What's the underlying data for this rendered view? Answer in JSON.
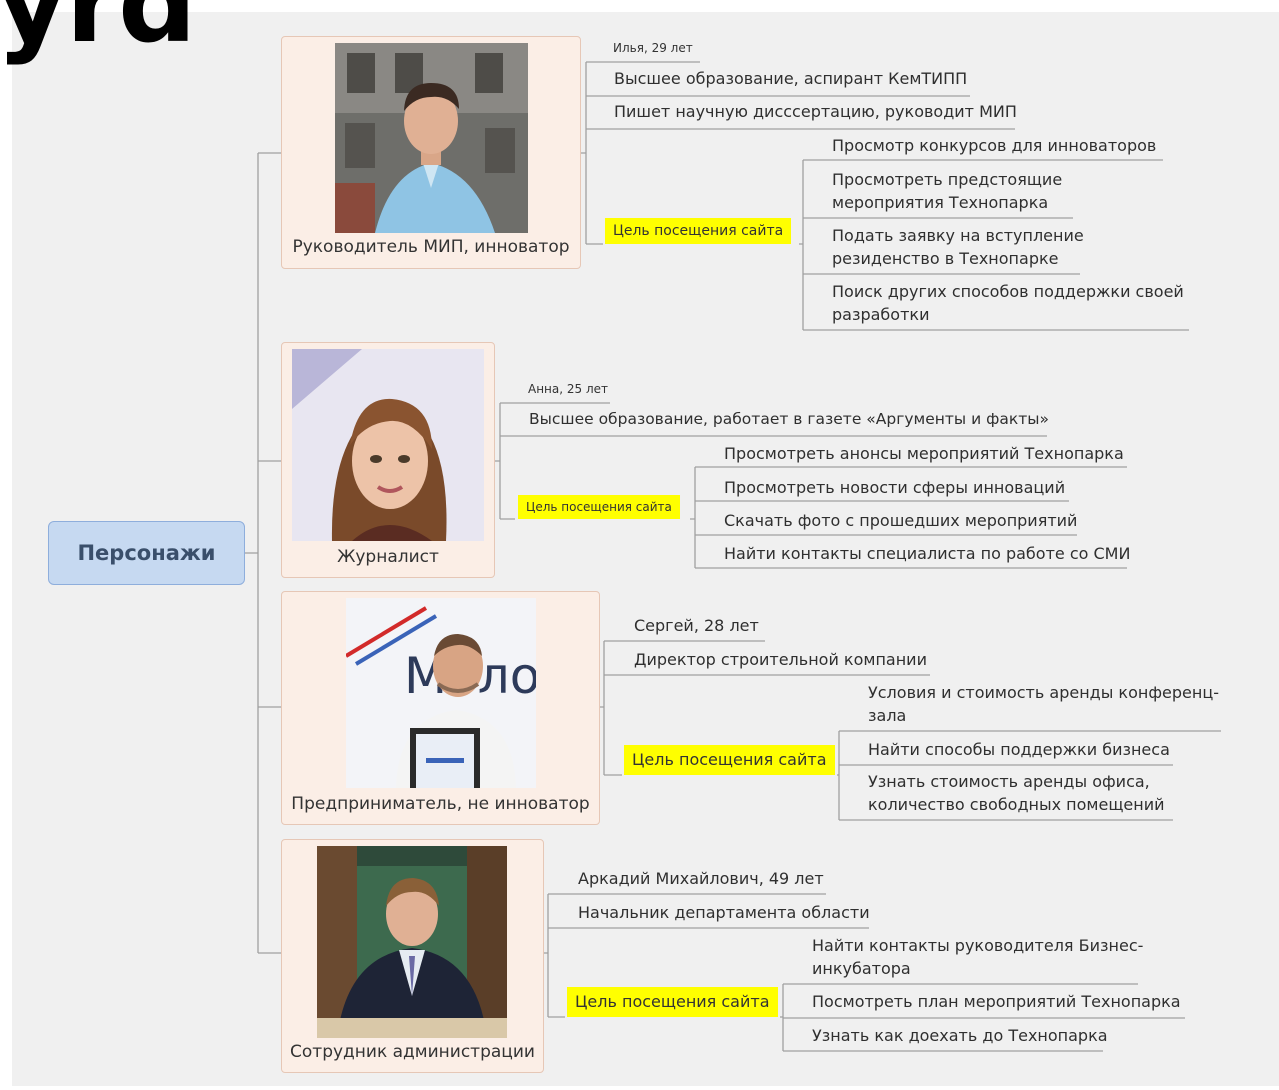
{
  "heading_fragment": "yrd",
  "root": "Персонажи",
  "personas": [
    {
      "caption": "Руководитель МИП, инноватор",
      "age": "Илья, 29 лет",
      "details": [
        "Высшее образование, аспирант КемТИПП",
        "Пишет научную дисссертацию, руководит МИП"
      ],
      "goal_label": "Цель посещения сайта",
      "goals": [
        "Просмотр конкурсов для инноваторов",
        "Просмотреть предстоящие\nмероприятия Технопарка",
        "Подать заявку на вступление\nрезиденство в Технопарке",
        "Поиск других способов поддержки своей\nразработки"
      ]
    },
    {
      "caption": "Журналист",
      "age": "Анна, 25 лет",
      "details": [
        "Высшее образование, работает в газете «Аргументы и факты»"
      ],
      "goal_label": "Цель посещения сайта",
      "goals": [
        "Просмотреть анонсы мероприятий Технопарка",
        "Просмотреть новости сферы инноваций",
        "Скачать фото с прошедших мероприятий",
        "Найти контакты специалиста по работе со СМИ"
      ]
    },
    {
      "caption": "Предприниматель, не инноватор",
      "details": [
        "Сергей, 28 лет",
        "Директор строительной компании"
      ],
      "goal_label": "Цель посещения сайта",
      "goals": [
        "Условия и стоимость аренды конференц-\nзала",
        "Найти способы поддержки бизнеса",
        "Узнать стоимость аренды офиса,\nколичество свободных помещений"
      ],
      "photo_text": "Молод"
    },
    {
      "caption": "Сотрудник администрации",
      "details": [
        "Аркадий Михайлович, 49 лет",
        "Начальник департамента области"
      ],
      "goal_label": "Цель посещения сайта",
      "goals": [
        "Найти контакты руководителя Бизнес-\nинкубатора",
        "Посмотреть план мероприятий Технопарка",
        "Узнать как доехать до Технопарка"
      ]
    }
  ],
  "colors": {
    "root_fill": "#c6d9f1",
    "card_fill": "#fbeee6",
    "goal_highlight": "#ffff00",
    "lines": "#a0a0a0"
  }
}
